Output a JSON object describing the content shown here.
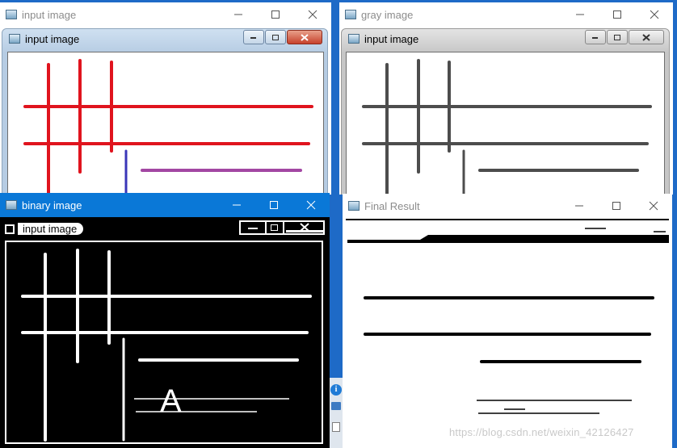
{
  "windows": {
    "input": {
      "title": "input image",
      "inner_title": "input image"
    },
    "gray": {
      "title": "gray image",
      "inner_title": "input image"
    },
    "binary": {
      "title": "binary image",
      "inner_title": "input image",
      "overlay_letter": "A"
    },
    "final": {
      "title": "Final Result"
    }
  },
  "icons": {
    "minimize": "minimize-icon",
    "maximize": "maximize-icon",
    "close": "close-icon",
    "app": "app-window-icon"
  },
  "colors": {
    "active_titlebar": "#0a78d7",
    "red_line": "#e0141e",
    "blue_line": "#3a36b8",
    "purple_line": "#a347a3",
    "gray_line": "#4d4d4d"
  },
  "watermark": "https://blog.csdn.net/weixin_42126427"
}
